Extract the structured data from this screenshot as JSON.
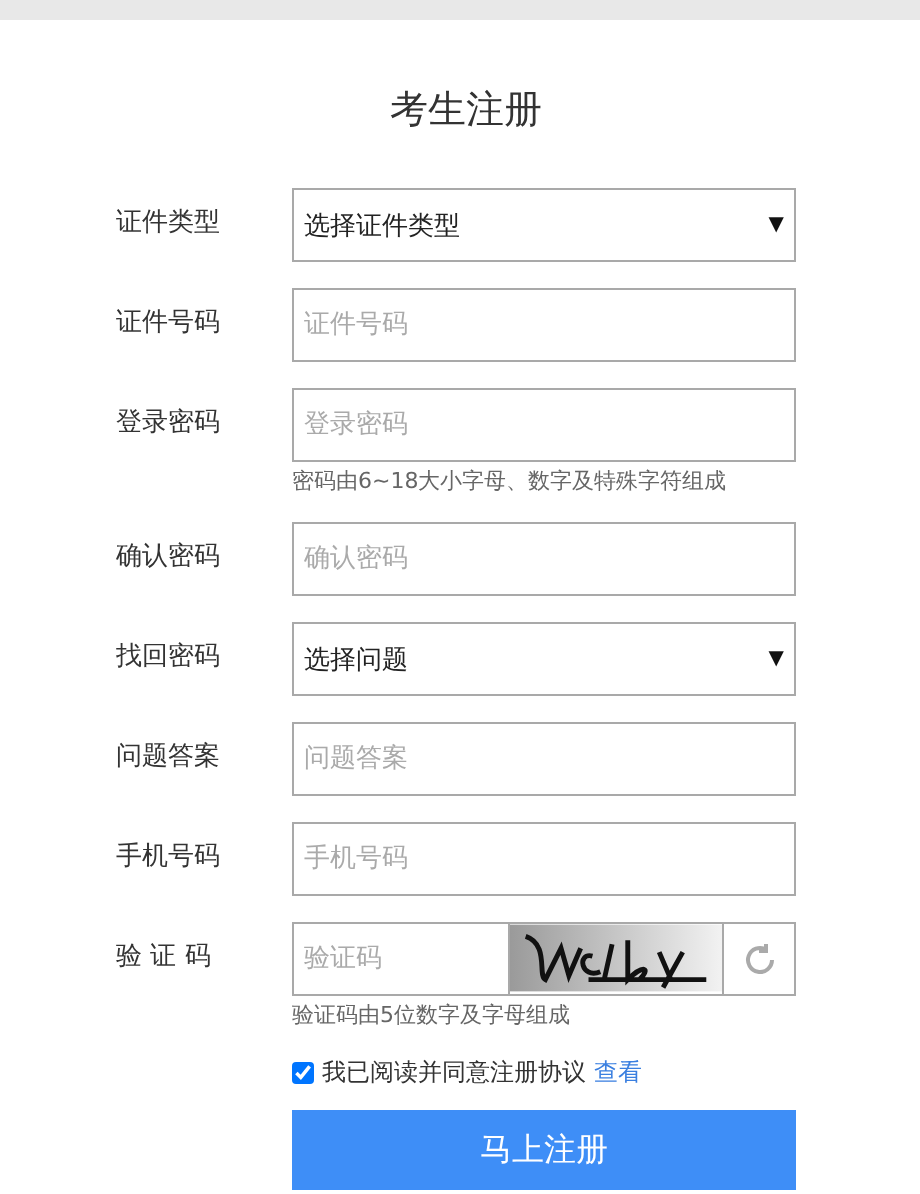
{
  "title": "考生注册",
  "fields": [
    {
      "kind": "select",
      "label": "证件类型",
      "value": "选择证件类型",
      "arrow": "▼"
    },
    {
      "kind": "input",
      "label": "证件号码",
      "placeholder": "证件号码"
    },
    {
      "kind": "input",
      "label": "登录密码",
      "placeholder": "登录密码",
      "hint": "密码由6~18大小字母、数字及特殊字符组成"
    },
    {
      "kind": "input",
      "label": "确认密码",
      "placeholder": "确认密码"
    },
    {
      "kind": "select",
      "label": "找回密码",
      "value": "选择问题",
      "arrow": "▼"
    },
    {
      "kind": "input",
      "label": "问题答案",
      "placeholder": "问题答案"
    },
    {
      "kind": "input",
      "label": "手机号码",
      "placeholder": "手机号码"
    },
    {
      "kind": "captcha",
      "label": "验 证 码",
      "placeholder": "验证码",
      "hint": "验证码由5位数字及字母组成"
    }
  ],
  "agreement": {
    "checked": true,
    "text": "我已阅读并同意注册协议",
    "link": "查看"
  },
  "submit": "马上注册"
}
